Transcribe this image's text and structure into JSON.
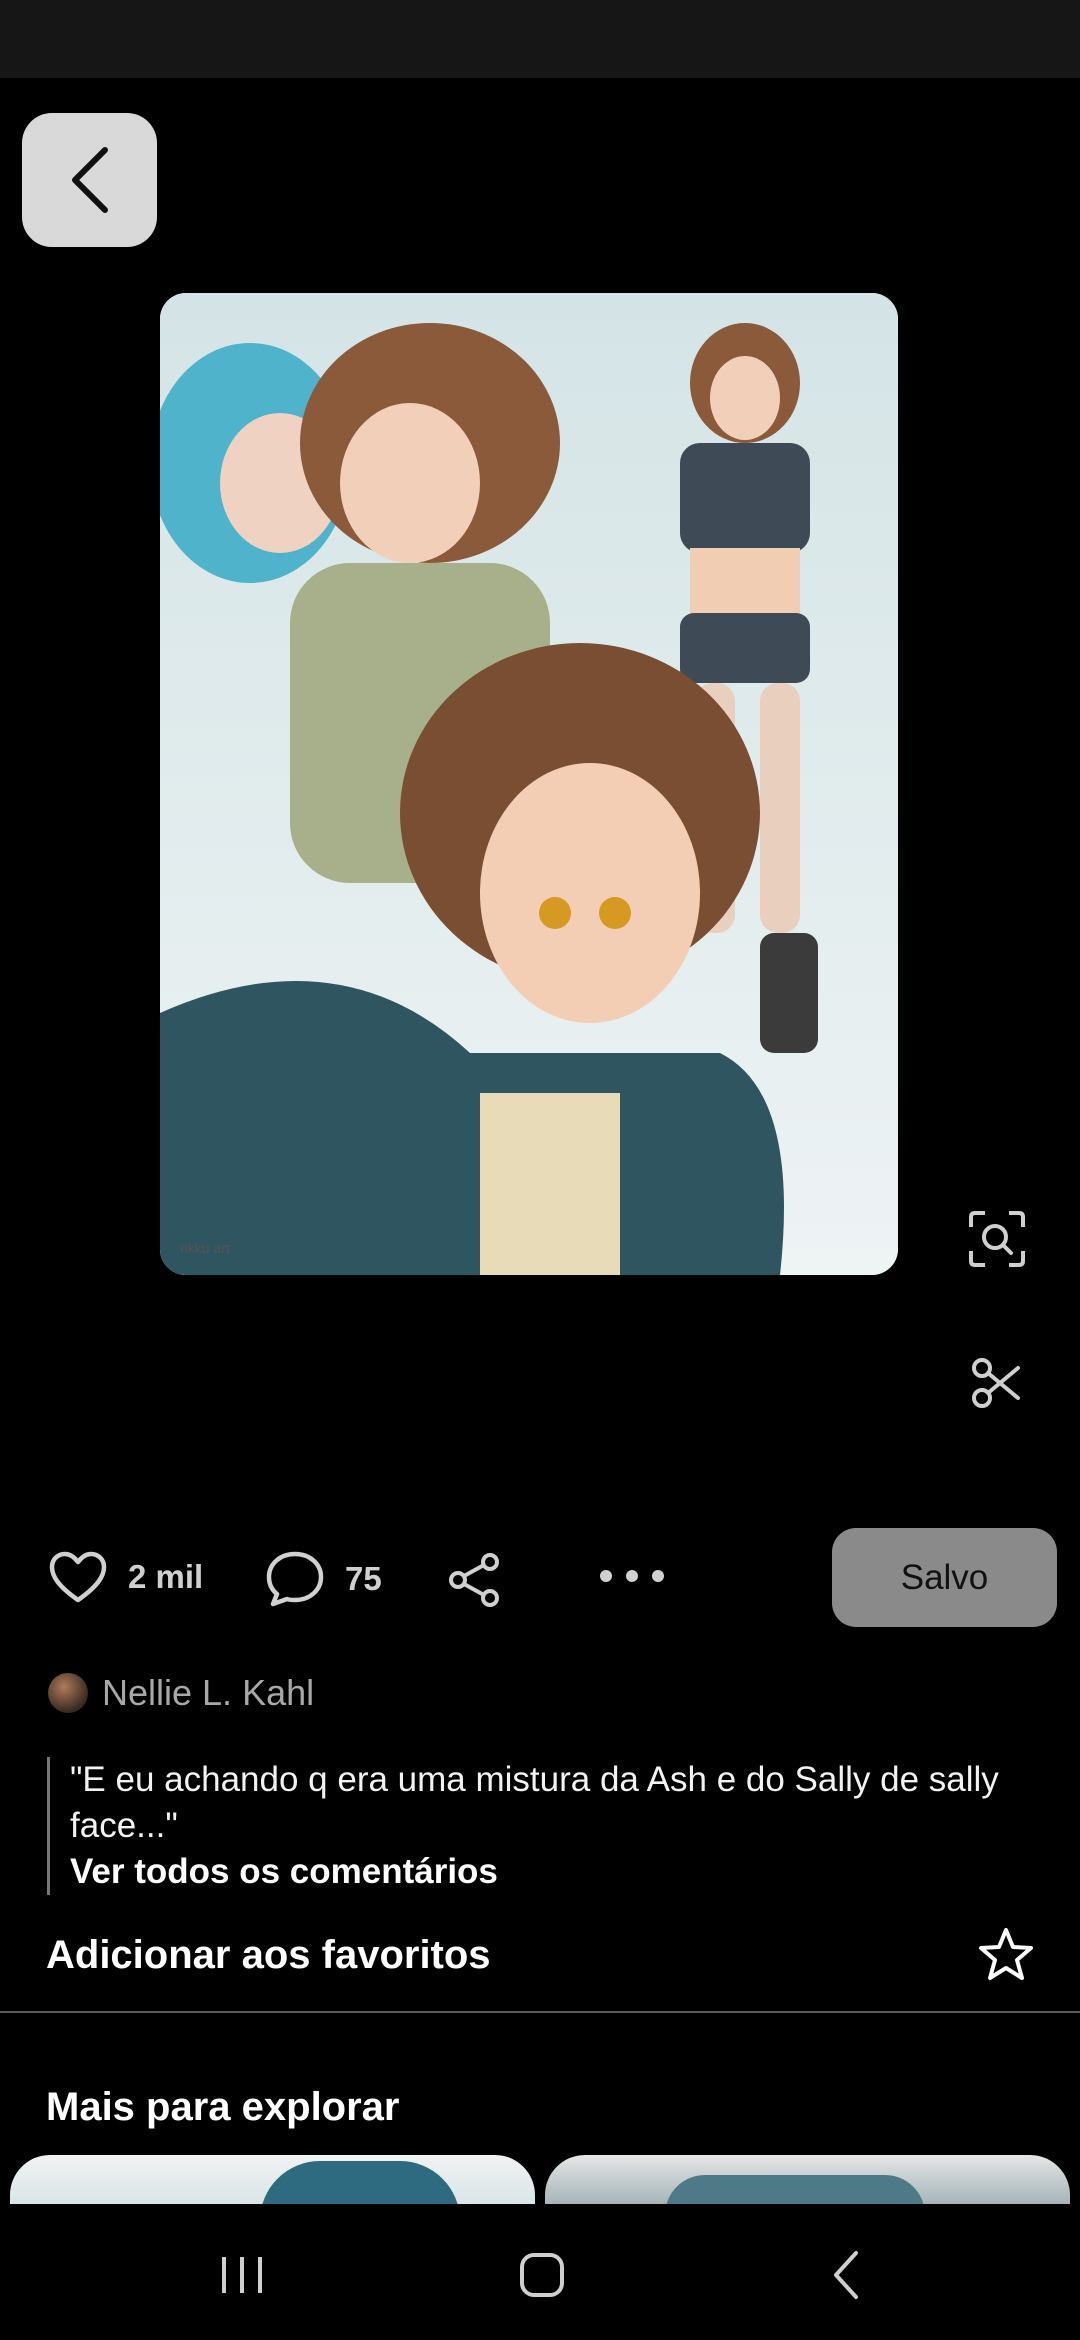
{
  "header": {
    "back_icon": "chevron-left-icon"
  },
  "pin": {
    "image_alt": "Illustrated character art",
    "watermark": "rikku art"
  },
  "side_tools": {
    "visual_search_icon": "lens-search-icon",
    "cutout_icon": "scissors-icon"
  },
  "actions": {
    "like_count": "2 mil",
    "comment_count": "75",
    "save_label": "Salvo"
  },
  "author": {
    "name": "Nellie L. Kahl"
  },
  "comment": {
    "text": "\"E eu achando q era uma mistura da Ash e do Sally de sally face...\"",
    "see_all_label": "Ver todos os comentários"
  },
  "favorites": {
    "label": "Adicionar aos favoritos"
  },
  "explore": {
    "title": "Mais para explorar"
  },
  "colors": {
    "background": "#000000",
    "save_button": "#8a8a8a",
    "back_button": "#d9d9d9"
  }
}
